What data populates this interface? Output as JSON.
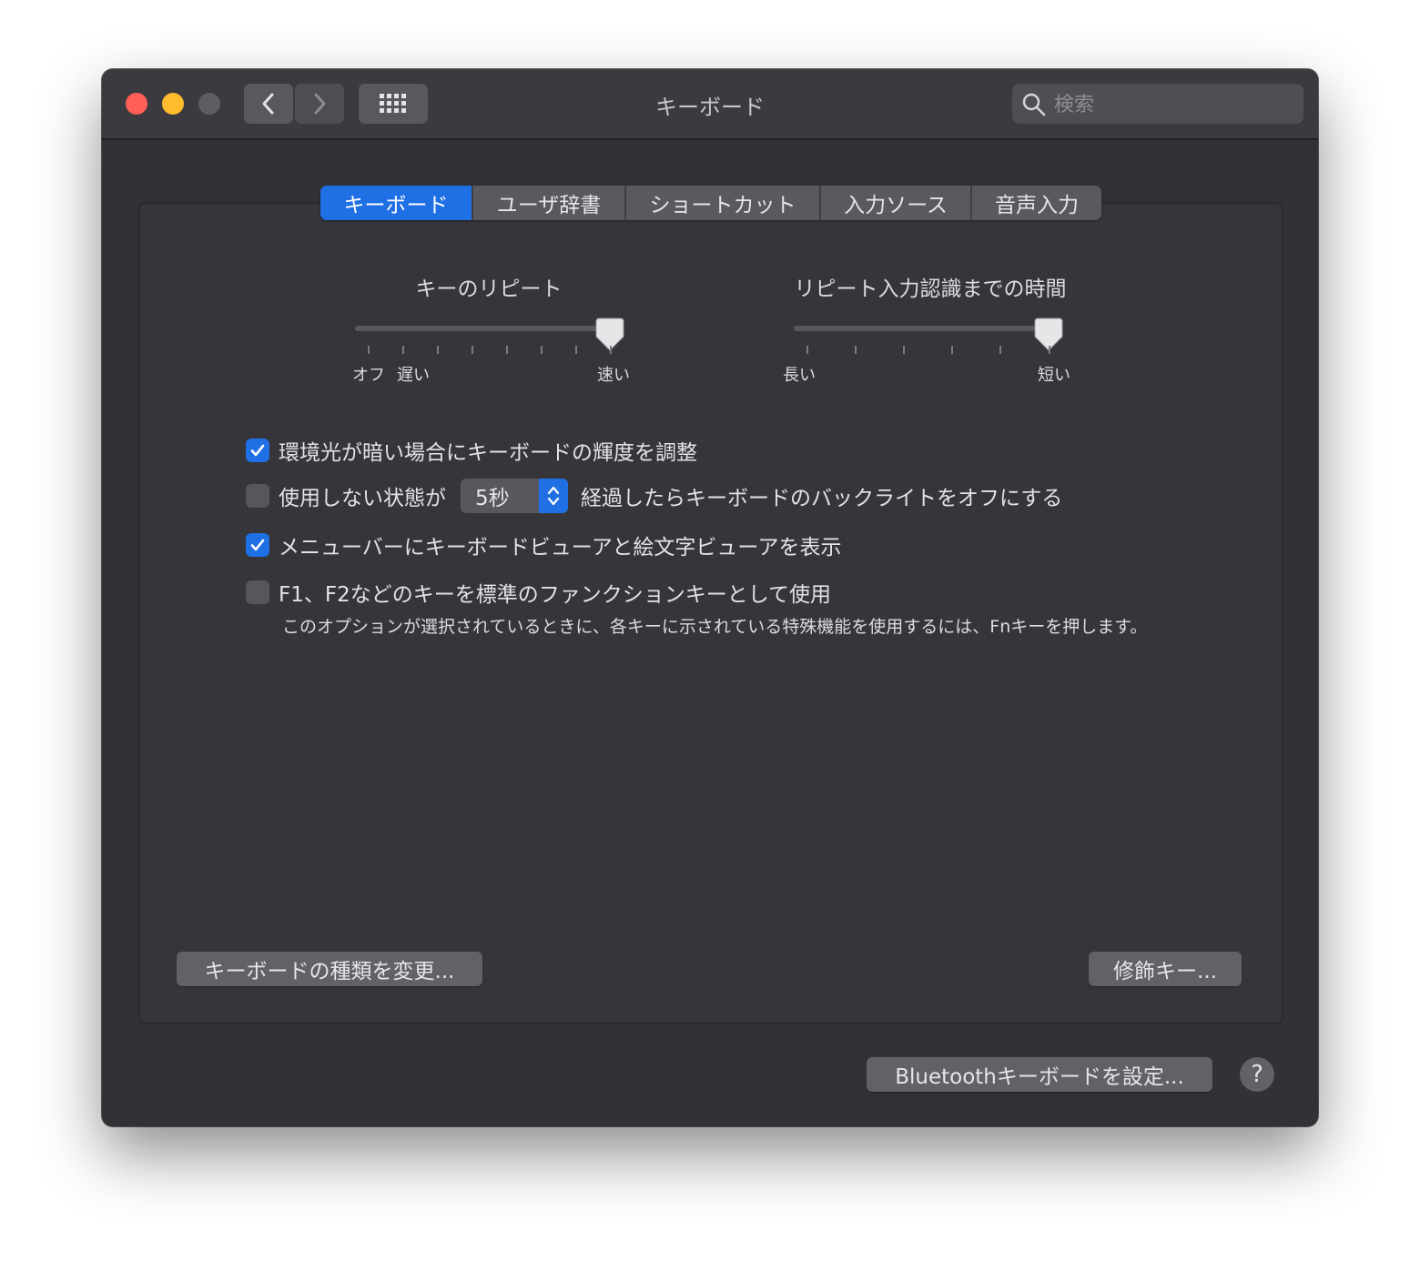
{
  "window": {
    "title": "キーボード"
  },
  "search": {
    "placeholder": "検索"
  },
  "tabs": [
    "キーボード",
    "ユーザ辞書",
    "ショートカット",
    "入力ソース",
    "音声入力"
  ],
  "key_repeat": {
    "title": "キーのリピート",
    "label_off": "オフ",
    "label_slow": "遅い",
    "label_fast": "速い",
    "level": 1.0
  },
  "repeat_delay": {
    "title": "リピート入力認識までの時間",
    "label_long": "長い",
    "label_short": "短い",
    "level": 1.0
  },
  "options": {
    "ambient": {
      "label": "環境光が暗い場合にキーボードの輝度を調整",
      "checked": true
    },
    "backlight": {
      "prefix": "使用しない状態が",
      "value": "5秒",
      "suffix": "経過したらキーボードのバックライトをオフにする",
      "checked": false
    },
    "menubar": {
      "label": "メニューバーにキーボードビューアと絵文字ビューアを表示",
      "checked": true
    },
    "fn_keys": {
      "label": "F1、F2などのキーを標準のファンクションキーとして使用",
      "note": "このオプションが選択されているときに、各キーに示されている特殊機能を使用するには、Fnキーを押します。",
      "checked": false
    }
  },
  "buttons": {
    "change_type": "キーボードの種類を変更...",
    "modifier": "修飾キー...",
    "bluetooth": "Bluetoothキーボードを設定...",
    "help": "?"
  },
  "colors": {
    "accent": "#1f6fe5",
    "close": "#ff5f57",
    "minimize": "#febc2e"
  }
}
